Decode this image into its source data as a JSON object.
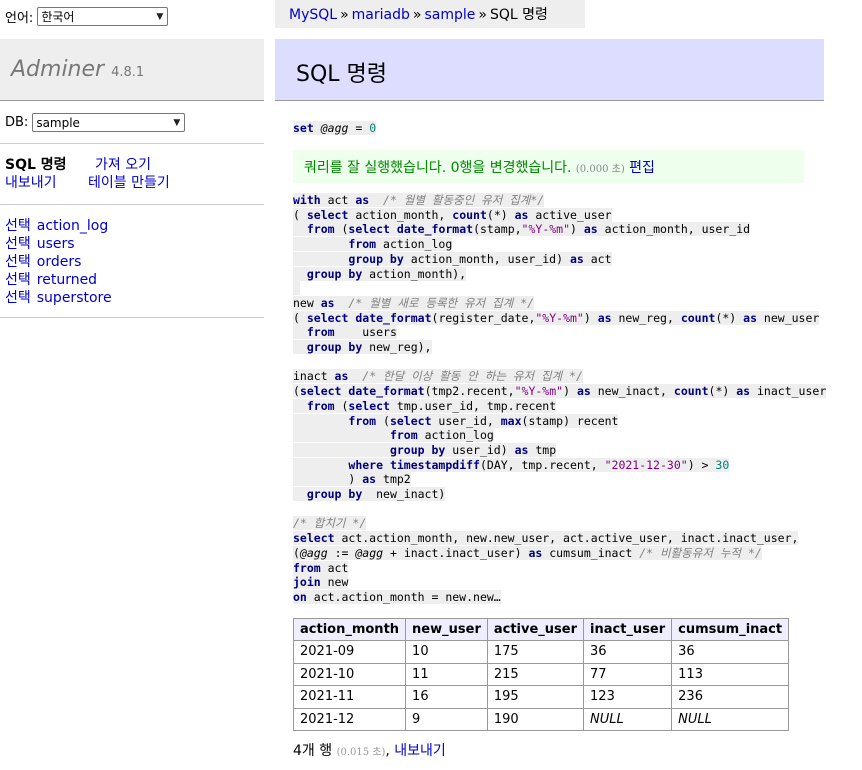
{
  "sidebar": {
    "language_label": "언어:",
    "language_value": "한국어",
    "app_name": "Adminer",
    "version": "4.8.1",
    "db_label": "DB:",
    "db_value": "sample",
    "links": {
      "sql_command": "SQL 명령",
      "import": "가져 오기",
      "export": "내보내기",
      "create_table": "테이블 만들기"
    },
    "select_label": "선택",
    "tables": [
      "action_log",
      "users",
      "orders",
      "returned",
      "superstore"
    ]
  },
  "breadcrumb": [
    "MySQL",
    "mariadb",
    "sample",
    "SQL 명령"
  ],
  "breadcrumb_sep": "»",
  "page_title": "SQL 명령",
  "set_statement": {
    "kw": "set",
    "var": "@agg",
    "op": "=",
    "val": "0"
  },
  "success": {
    "message": "쿼리를 잘 실행했습니다. 0행을 변경했습니다.",
    "time": "(0.000 초)",
    "edit_link": "편집"
  },
  "results": {
    "columns": [
      "action_month",
      "new_user",
      "active_user",
      "inact_user",
      "cumsum_inact"
    ],
    "rows": [
      [
        "2021-09",
        "10",
        "175",
        "36",
        "36"
      ],
      [
        "2021-10",
        "11",
        "215",
        "77",
        "113"
      ],
      [
        "2021-11",
        "16",
        "195",
        "123",
        "236"
      ],
      [
        "2021-12",
        "9",
        "190",
        "NULL",
        "NULL"
      ]
    ]
  },
  "footer": {
    "rows_text": "4개 행",
    "time": "(0.015 초)",
    "export_link": "내보내기"
  }
}
